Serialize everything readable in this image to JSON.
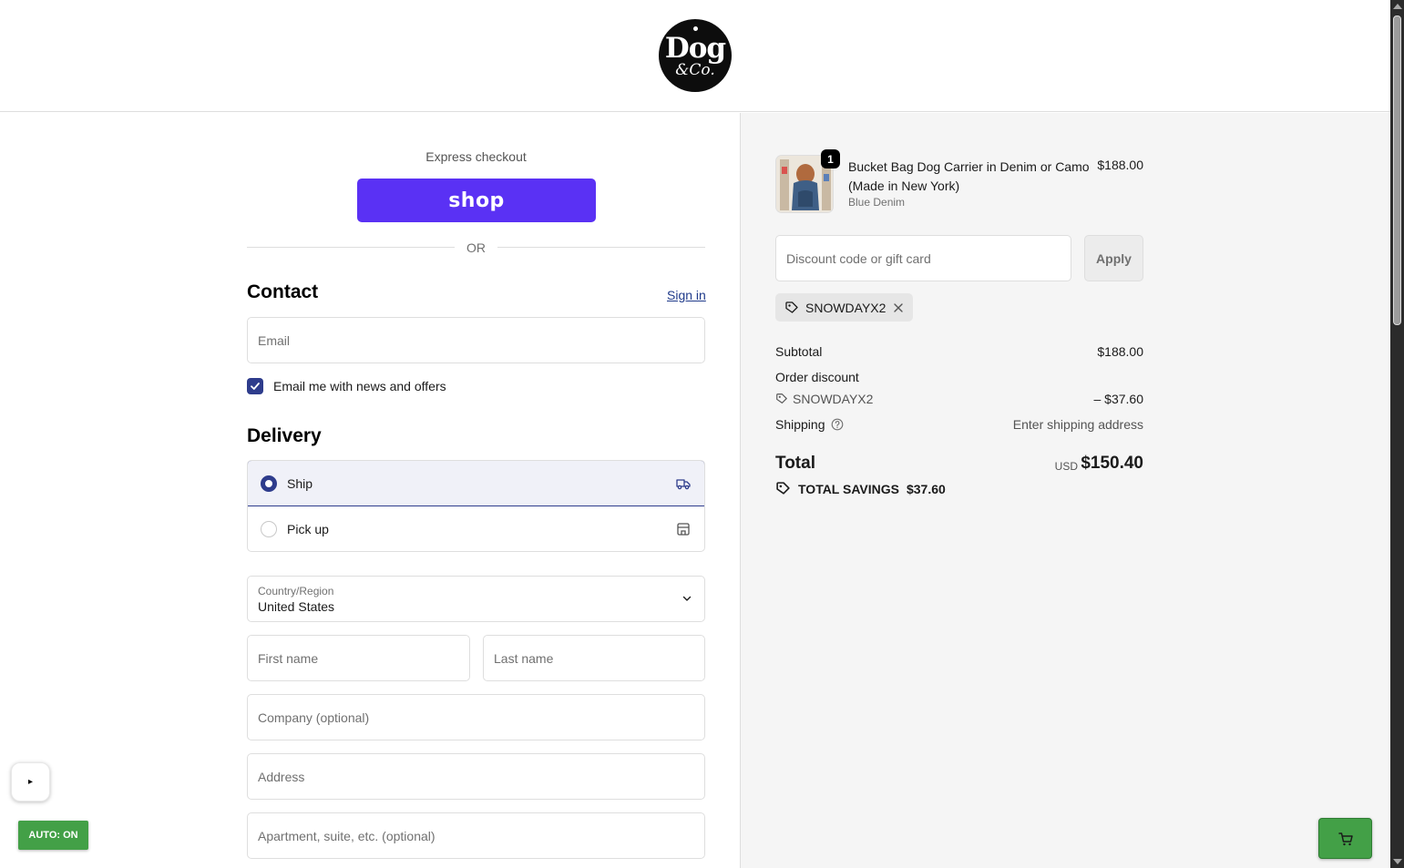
{
  "header": {
    "logo": {
      "line1": "Dog",
      "line2": "&Co."
    }
  },
  "express": {
    "label": "Express checkout",
    "shop_button": "shop",
    "divider": "OR"
  },
  "contact": {
    "title": "Contact",
    "sign_in": "Sign in",
    "email_placeholder": "Email",
    "newsletter_label": "Email me with news and offers",
    "newsletter_checked": true
  },
  "delivery": {
    "title": "Delivery",
    "options": [
      {
        "label": "Ship",
        "selected": true,
        "icon": "truck-icon"
      },
      {
        "label": "Pick up",
        "selected": false,
        "icon": "store-icon"
      }
    ],
    "country_label": "Country/Region",
    "country_value": "United States",
    "first_name_placeholder": "First name",
    "last_name_placeholder": "Last name",
    "company_placeholder": "Company (optional)",
    "address_placeholder": "Address",
    "apartment_placeholder": "Apartment, suite, etc. (optional)"
  },
  "summary": {
    "product": {
      "title": "Bucket Bag Dog Carrier in Denim or Camo (Made in New York)",
      "variant": "Blue Denim",
      "price": "$188.00",
      "quantity": "1"
    },
    "discount_placeholder": "Discount code or gift card",
    "apply_label": "Apply",
    "applied_code": "SNOWDAYX2",
    "subtotal_label": "Subtotal",
    "subtotal_value": "$188.00",
    "order_discount_label": "Order discount",
    "discount_code": "SNOWDAYX2",
    "discount_value": "– $37.60",
    "shipping_label": "Shipping",
    "shipping_value": "Enter shipping address",
    "total_label": "Total",
    "currency": "USD",
    "total_value": "$150.40",
    "savings_label": "TOTAL SAVINGS",
    "savings_value": "$37.60"
  },
  "overlays": {
    "play": "▸",
    "auto_label": "AUTO: ON"
  },
  "colors": {
    "shop_purple": "#5a31f4",
    "accent_navy": "#2e3c8c",
    "summary_bg": "#f5f5f5",
    "overlay_green": "#43a047"
  }
}
